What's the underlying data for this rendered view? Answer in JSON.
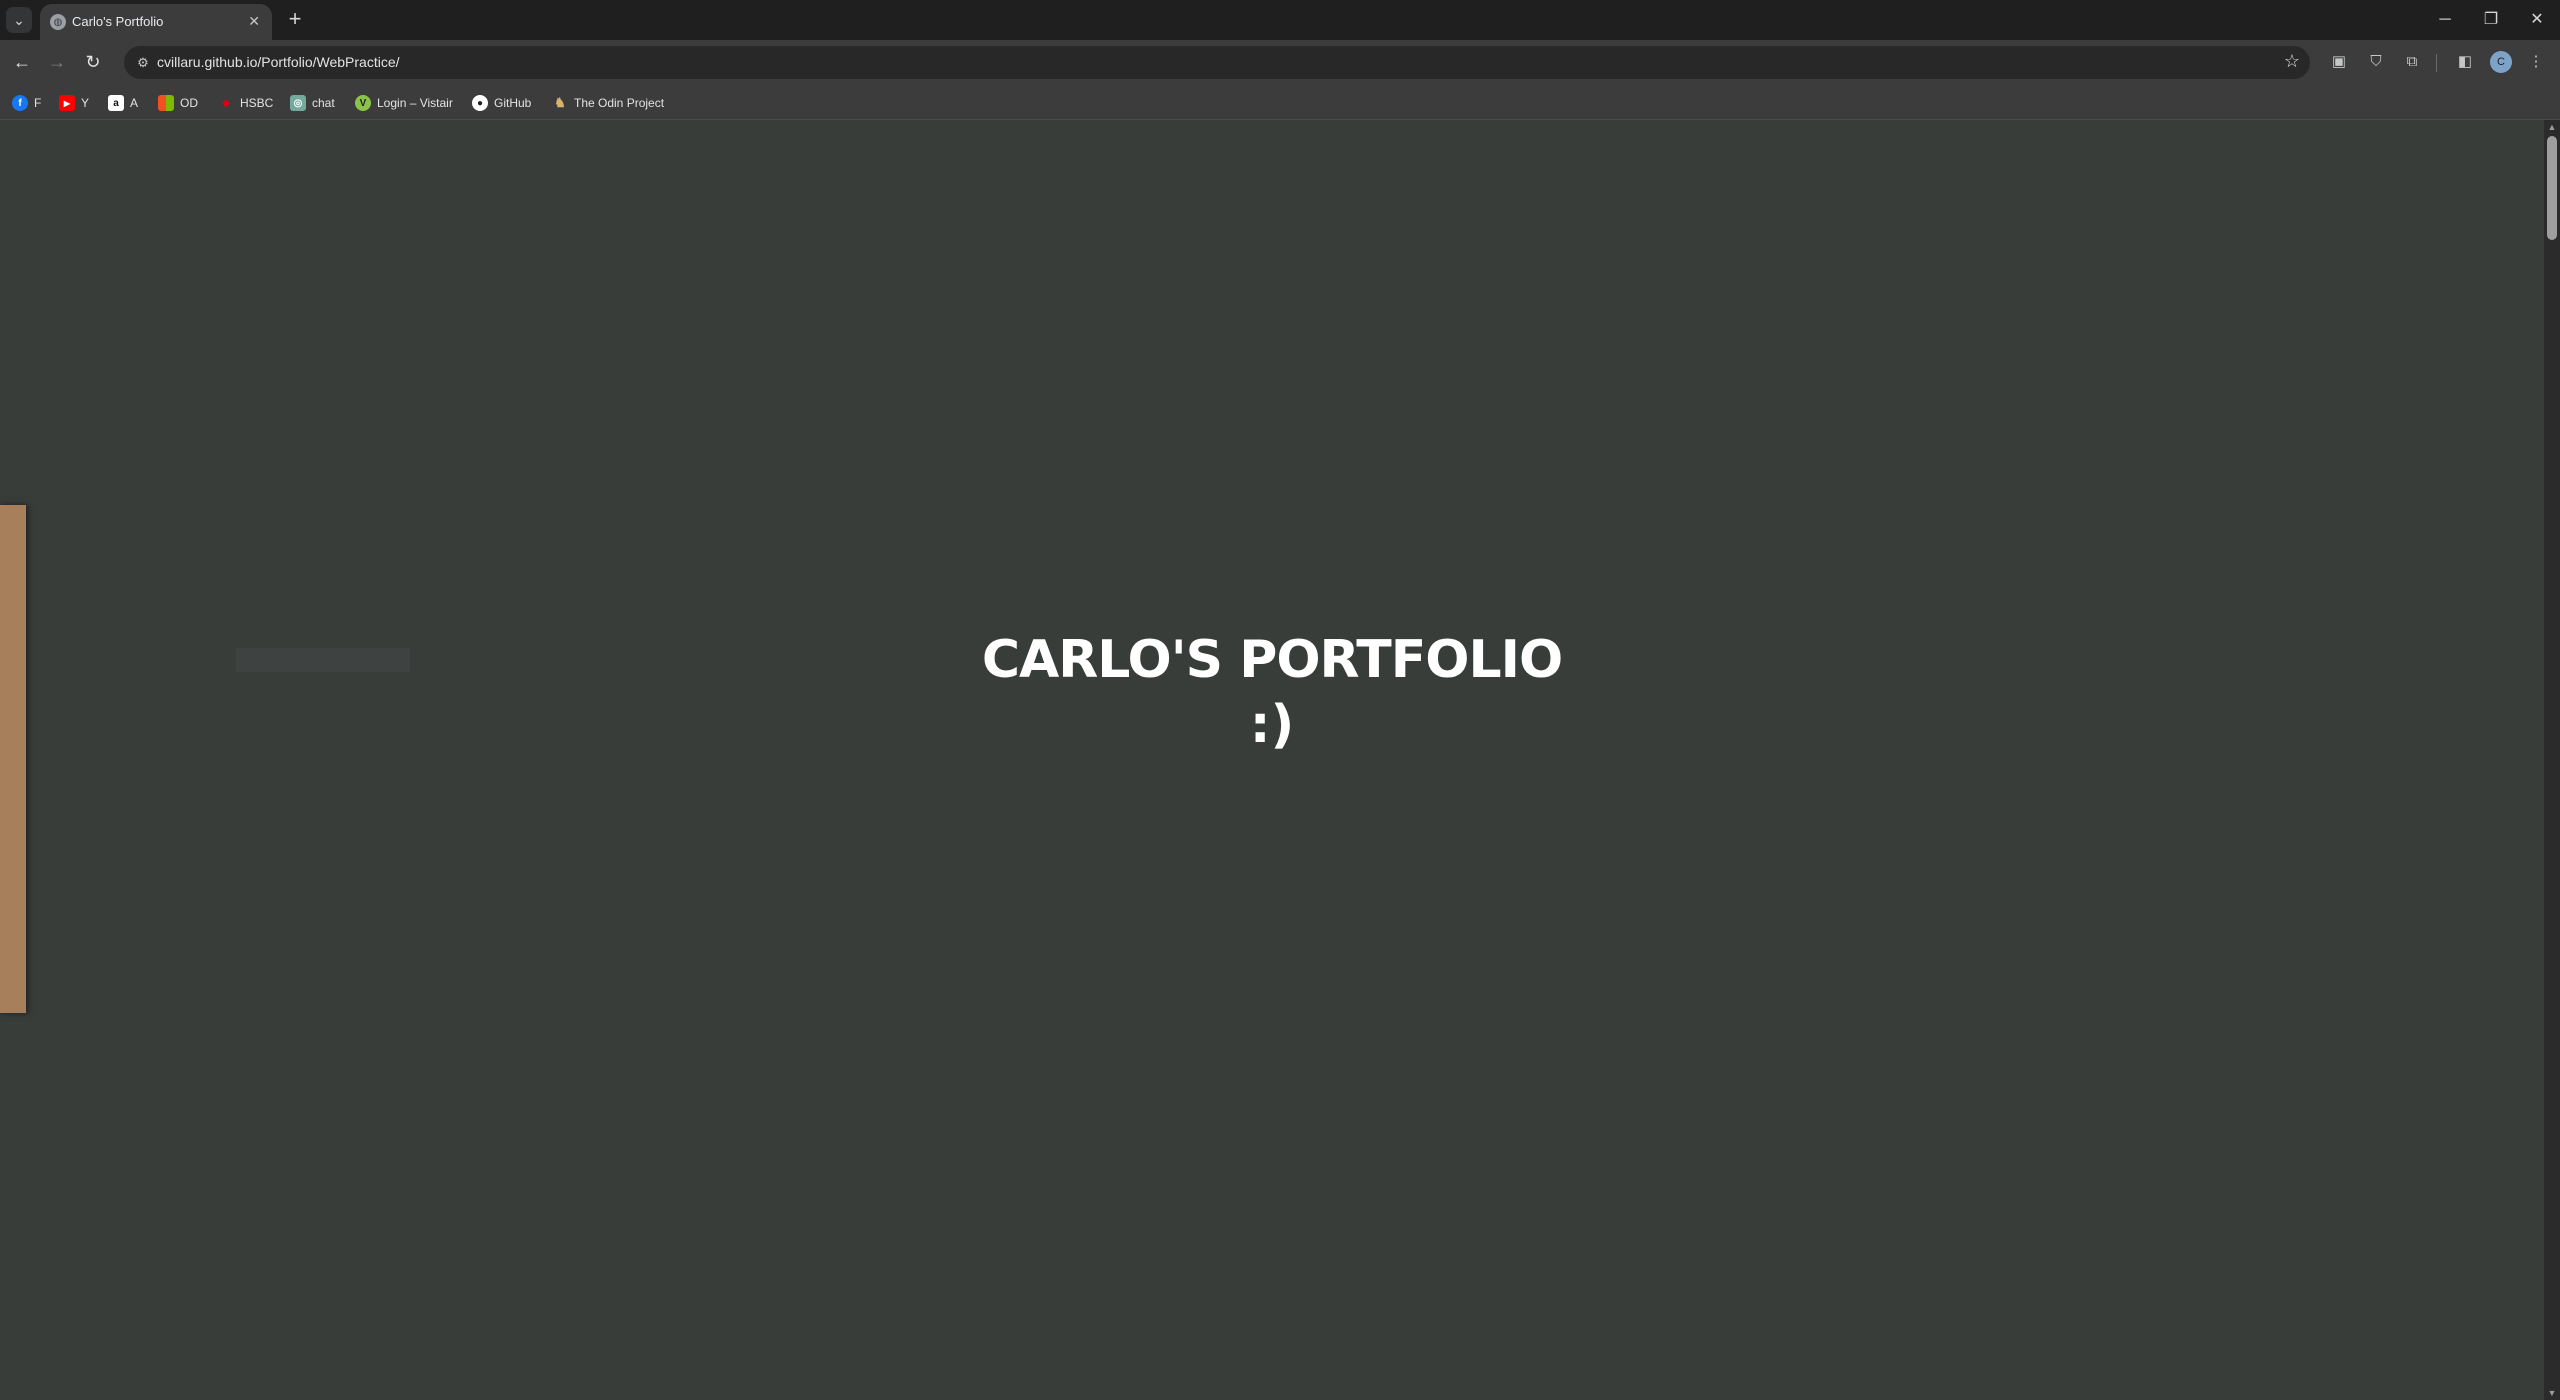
{
  "browser": {
    "tab": {
      "title": "Carlo's Portfolio",
      "close": "✕"
    },
    "new_tab": "+",
    "window_controls": {
      "minimize": "─",
      "restore": "❐",
      "close": "✕"
    },
    "address": {
      "url": "cvillaru.github.io/Portfolio/WebPractice/"
    },
    "profile_initial": "C"
  },
  "bookmarks": [
    {
      "label": "F",
      "icon": "facebook-icon",
      "color": "#1877f2",
      "glyph": "f"
    },
    {
      "label": "Y",
      "icon": "youtube-icon",
      "color": "#ff0000",
      "glyph": "▶"
    },
    {
      "label": "A",
      "icon": "amazon-icon",
      "color": "#ffffff",
      "glyph": "a"
    },
    {
      "label": "OD",
      "icon": "microsoft-icon",
      "color": "#f25022",
      "glyph": "▦"
    },
    {
      "label": "HSBC",
      "icon": "hsbc-icon",
      "color": "#db0011",
      "glyph": "◆"
    },
    {
      "label": "chat",
      "icon": "chatgpt-icon",
      "color": "#74aa9c",
      "glyph": "◎"
    },
    {
      "label": "Login – Vistair",
      "icon": "vistair-icon",
      "color": "#8bc34a",
      "glyph": "V"
    },
    {
      "label": "GitHub",
      "icon": "github-icon",
      "color": "#ffffff",
      "glyph": "●"
    },
    {
      "label": "The Odin Project",
      "icon": "odin-project-icon",
      "color": "#d9b36c",
      "glyph": "♞"
    }
  ],
  "page": {
    "title": "CARLO'S PORTFOLIO",
    "subtitle": ":)",
    "side_panel_color": "#a77f5b",
    "background": "#393d3a"
  }
}
